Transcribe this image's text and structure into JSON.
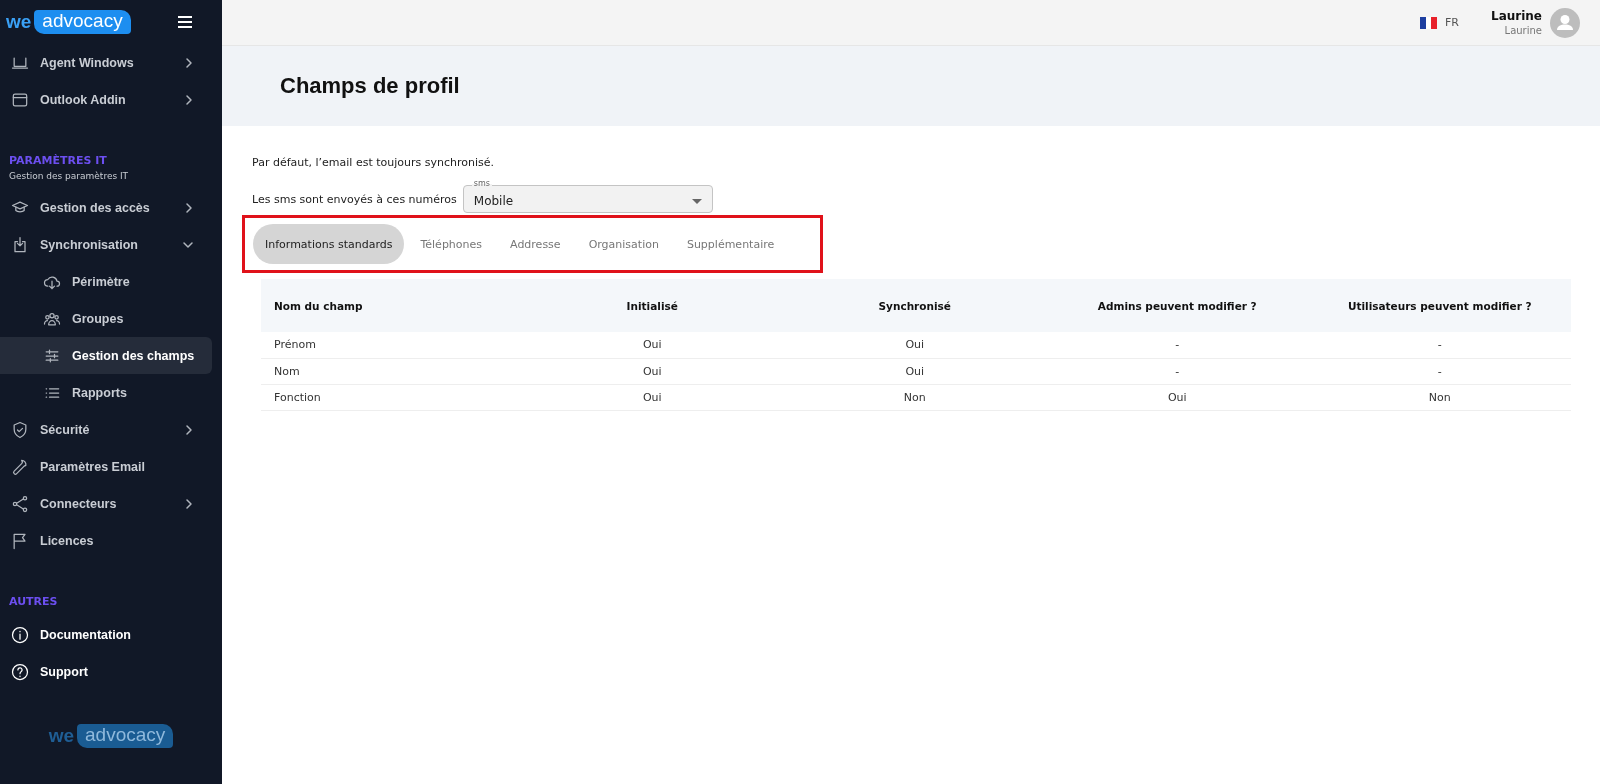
{
  "sidebar": {
    "logo": {
      "prefix": "we",
      "word": "advocacy"
    },
    "items": [
      {
        "kind": "item",
        "label": "Agent Windows",
        "expanded": false,
        "selected": false
      },
      {
        "kind": "item",
        "label": "Outlook Addin",
        "expanded": false,
        "selected": false
      },
      {
        "kind": "section",
        "label": "PARAMÈTRES IT",
        "subtitle": "Gestion des paramètres IT"
      },
      {
        "kind": "item",
        "label": "Gestion des accès",
        "expanded": false,
        "selected": false
      },
      {
        "kind": "item",
        "label": "Synchronisation",
        "expanded": true,
        "selected": false
      },
      {
        "kind": "subitem",
        "label": "Périmètre",
        "selected": false
      },
      {
        "kind": "subitem",
        "label": "Groupes",
        "selected": false
      },
      {
        "kind": "subitem",
        "label": "Gestion des champs",
        "selected": true
      },
      {
        "kind": "subitem",
        "label": "Rapports",
        "selected": false
      },
      {
        "kind": "item",
        "label": "Sécurité",
        "expanded": false,
        "selected": false
      },
      {
        "kind": "item",
        "label": "Paramètres Email",
        "selected": false
      },
      {
        "kind": "item",
        "label": "Connecteurs",
        "expanded": false,
        "selected": false
      },
      {
        "kind": "item",
        "label": "Licences",
        "selected": false
      },
      {
        "kind": "section",
        "label": "AUTRES"
      },
      {
        "kind": "link",
        "label": "Documentation",
        "selected": false
      },
      {
        "kind": "link",
        "label": "Support",
        "selected": false
      }
    ],
    "footer_logo": {
      "prefix": "we",
      "word": "advocacy"
    }
  },
  "topbar": {
    "language": "FR",
    "user": {
      "name": "Laurine",
      "subtitle": "Laurine"
    }
  },
  "page": {
    "title": "Champs de profil",
    "note": "Par défaut, l’email est toujours synchronisé.",
    "sms": {
      "label": "Les sms sont envoyés à ces numéros",
      "field_label": "sms",
      "value": "Mobile"
    },
    "tabs": [
      {
        "label": "Informations standards",
        "selected": true
      },
      {
        "label": "Téléphones",
        "selected": false
      },
      {
        "label": "Addresse",
        "selected": false
      },
      {
        "label": "Organisation",
        "selected": false
      },
      {
        "label": "Supplémentaire",
        "selected": false
      }
    ],
    "table": {
      "columns": [
        "Nom du champ",
        "Initialisé",
        "Synchronisé",
        "Admins peuvent modifier ?",
        "Utilisateurs peuvent modifier ?"
      ],
      "rows": [
        [
          "Prénom",
          "Oui",
          "Oui",
          "-",
          "-"
        ],
        [
          "Nom",
          "Oui",
          "Oui",
          "-",
          "-"
        ],
        [
          "Fonction",
          "Oui",
          "Non",
          "Oui",
          "Non"
        ]
      ]
    }
  }
}
